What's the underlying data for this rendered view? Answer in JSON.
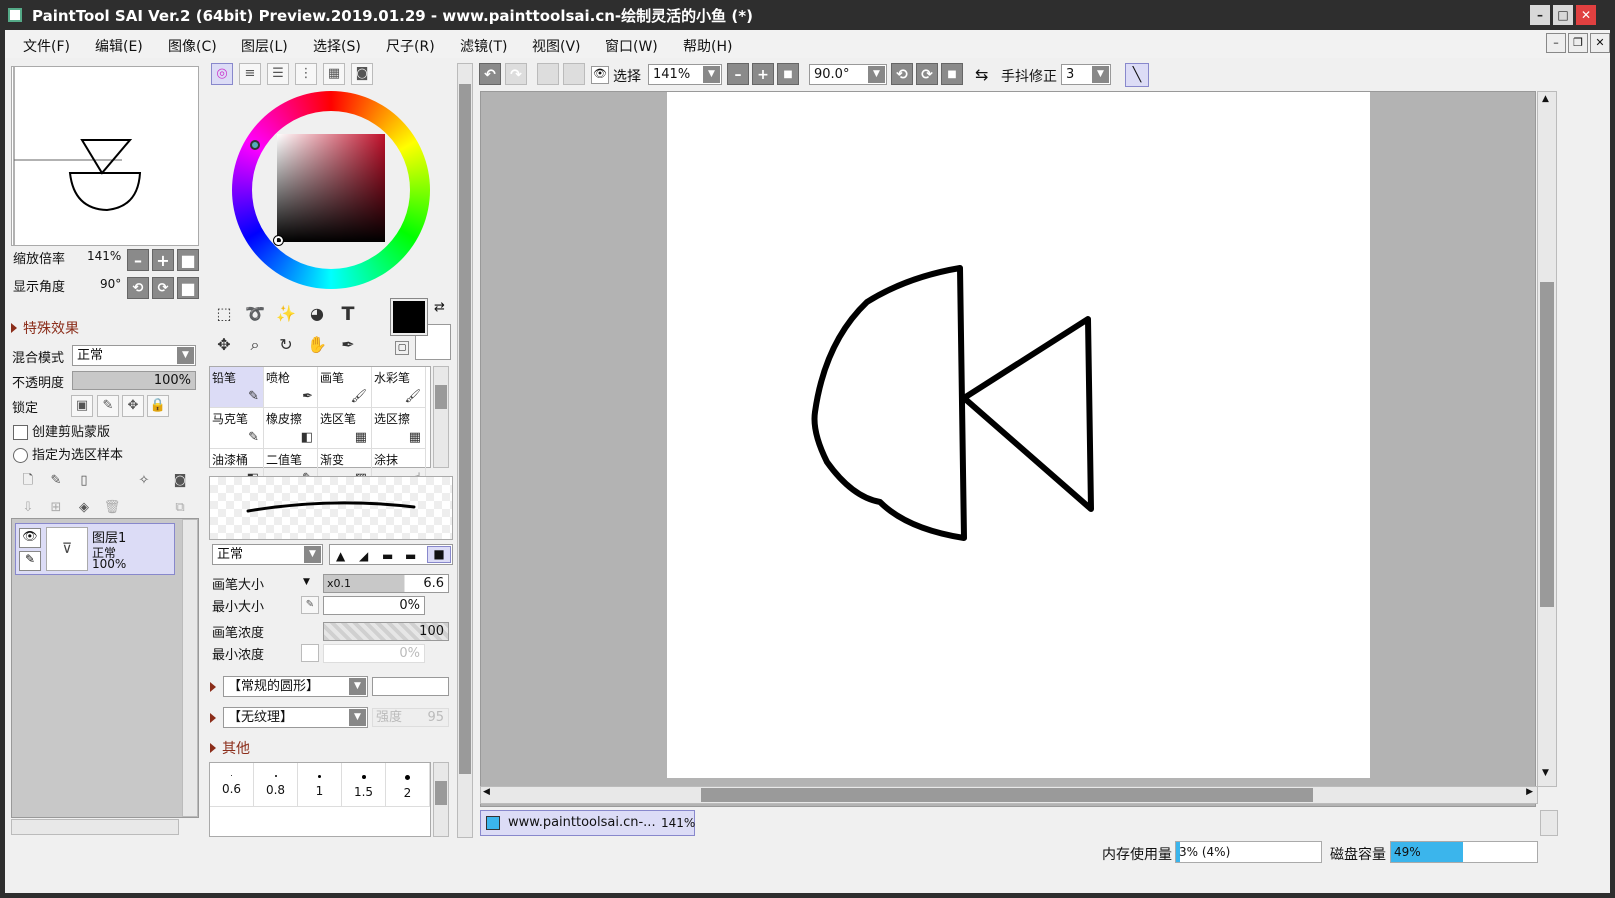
{
  "window": {
    "title": "PaintTool SAI Ver.2 (64bit) Preview.2019.01.29 - www.painttoolsai.cn-绘制灵活的小鱼 (*)"
  },
  "menu": [
    "文件(F)",
    "编辑(E)",
    "图像(C)",
    "图层(L)",
    "选择(S)",
    "尺子(R)",
    "滤镜(T)",
    "视图(V)",
    "窗口(W)",
    "帮助(H)"
  ],
  "navigator": {
    "zoom_label": "缩放倍率",
    "zoom_value": "141%",
    "angle_label": "显示角度",
    "angle_value": "90°"
  },
  "layer_panel": {
    "effects_label": "特殊效果",
    "blend_label": "混合模式",
    "blend_value": "正常",
    "opacity_label": "不透明度",
    "opacity_value": "100%",
    "lock_label": "锁定",
    "clip_label": "创建剪贴蒙版",
    "sample_label": "指定为选区样本",
    "layer": {
      "name": "图层1",
      "mode": "正常",
      "opacity": "100%"
    }
  },
  "brushes": [
    [
      "铅笔",
      "喷枪",
      "画笔",
      "水彩笔"
    ],
    [
      "马克笔",
      "橡皮擦",
      "选区笔",
      "选区擦"
    ],
    [
      "油漆桶",
      "二值笔",
      "渐变",
      "涂抹"
    ]
  ],
  "brush_settings": {
    "mode": "正常",
    "size_label": "画笔大小",
    "size_mult": "x0.1",
    "size_value": "6.6",
    "min_size_label": "最小大小",
    "min_size_value": "0%",
    "density_label": "画笔浓度",
    "density_value": "100",
    "min_density_label": "最小浓度",
    "min_density_value": "0%",
    "shape": "【常规的圆形】",
    "texture": "【无纹理】",
    "texture_strength_label": "强度",
    "texture_strength_value": "95",
    "other_label": "其他"
  },
  "size_presets": [
    "0.6",
    "0.8",
    "1",
    "1.5",
    "2"
  ],
  "canvas_toolbar": {
    "select_label": "选择",
    "zoom": "141%",
    "angle": "90.0°",
    "stabilizer_label": "手抖修正",
    "stabilizer_value": "3"
  },
  "doc_tab": {
    "name": "www.painttoolsai.cn-...",
    "zoom": "141%"
  },
  "status": {
    "memory_label": "内存使用量",
    "memory_value": "3% (4%)",
    "memory_pct": 3,
    "disk_label": "磁盘容量",
    "disk_value": "49%",
    "disk_pct": 49
  },
  "colors": {
    "accent": "#3bb5ec",
    "selection": "#dcdcf6",
    "primary": "#000000",
    "secondary": "#ffffff"
  }
}
